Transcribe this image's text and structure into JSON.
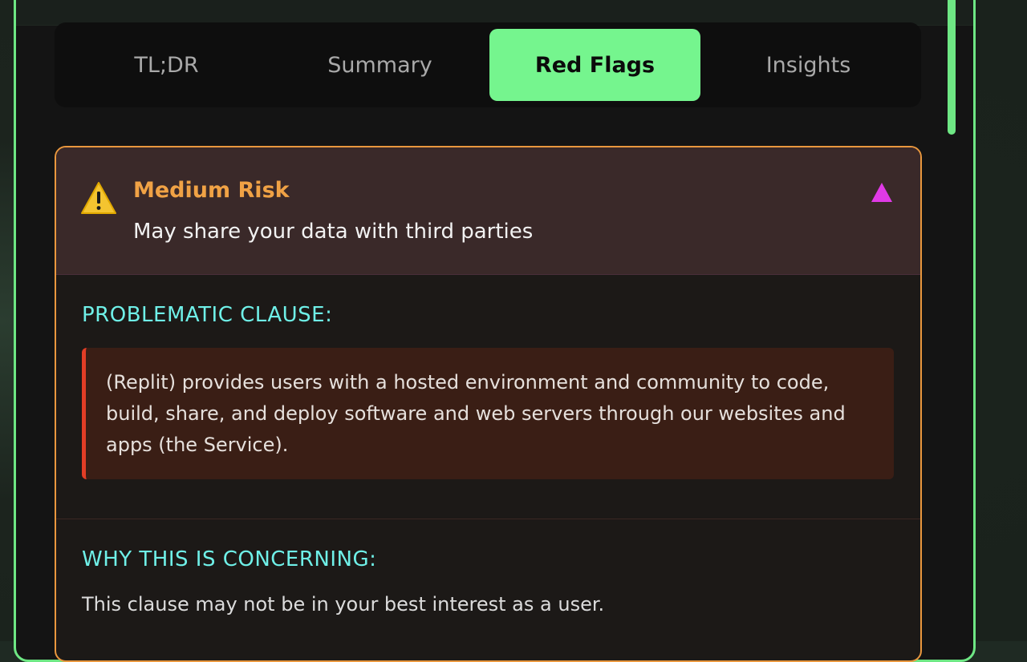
{
  "tabs": [
    {
      "label": "TL;DR",
      "active": false
    },
    {
      "label": "Summary",
      "active": false
    },
    {
      "label": "Red Flags",
      "active": true
    },
    {
      "label": "Insights",
      "active": false
    }
  ],
  "flag": {
    "icon": "warning-icon",
    "risk_level": "Medium Risk",
    "description": "May share your data with third parties",
    "toggle_icon": "collapse-triangle-icon",
    "clause_label": "PROBLEMATIC CLAUSE:",
    "clause_text": "(Replit) provides users with a hosted environment and community to code, build, share, and deploy software and web servers through our websites and apps (the Service).",
    "concern_label": "WHY THIS IS CONCERNING:",
    "concern_text": "This clause may not be in your best interest as a user."
  },
  "colors": {
    "accent": "#75f58e",
    "risk_medium": "#f0a245",
    "section_label": "#6ff0e8",
    "clause_border": "#e23d26",
    "toggle": "#e03ae6"
  }
}
